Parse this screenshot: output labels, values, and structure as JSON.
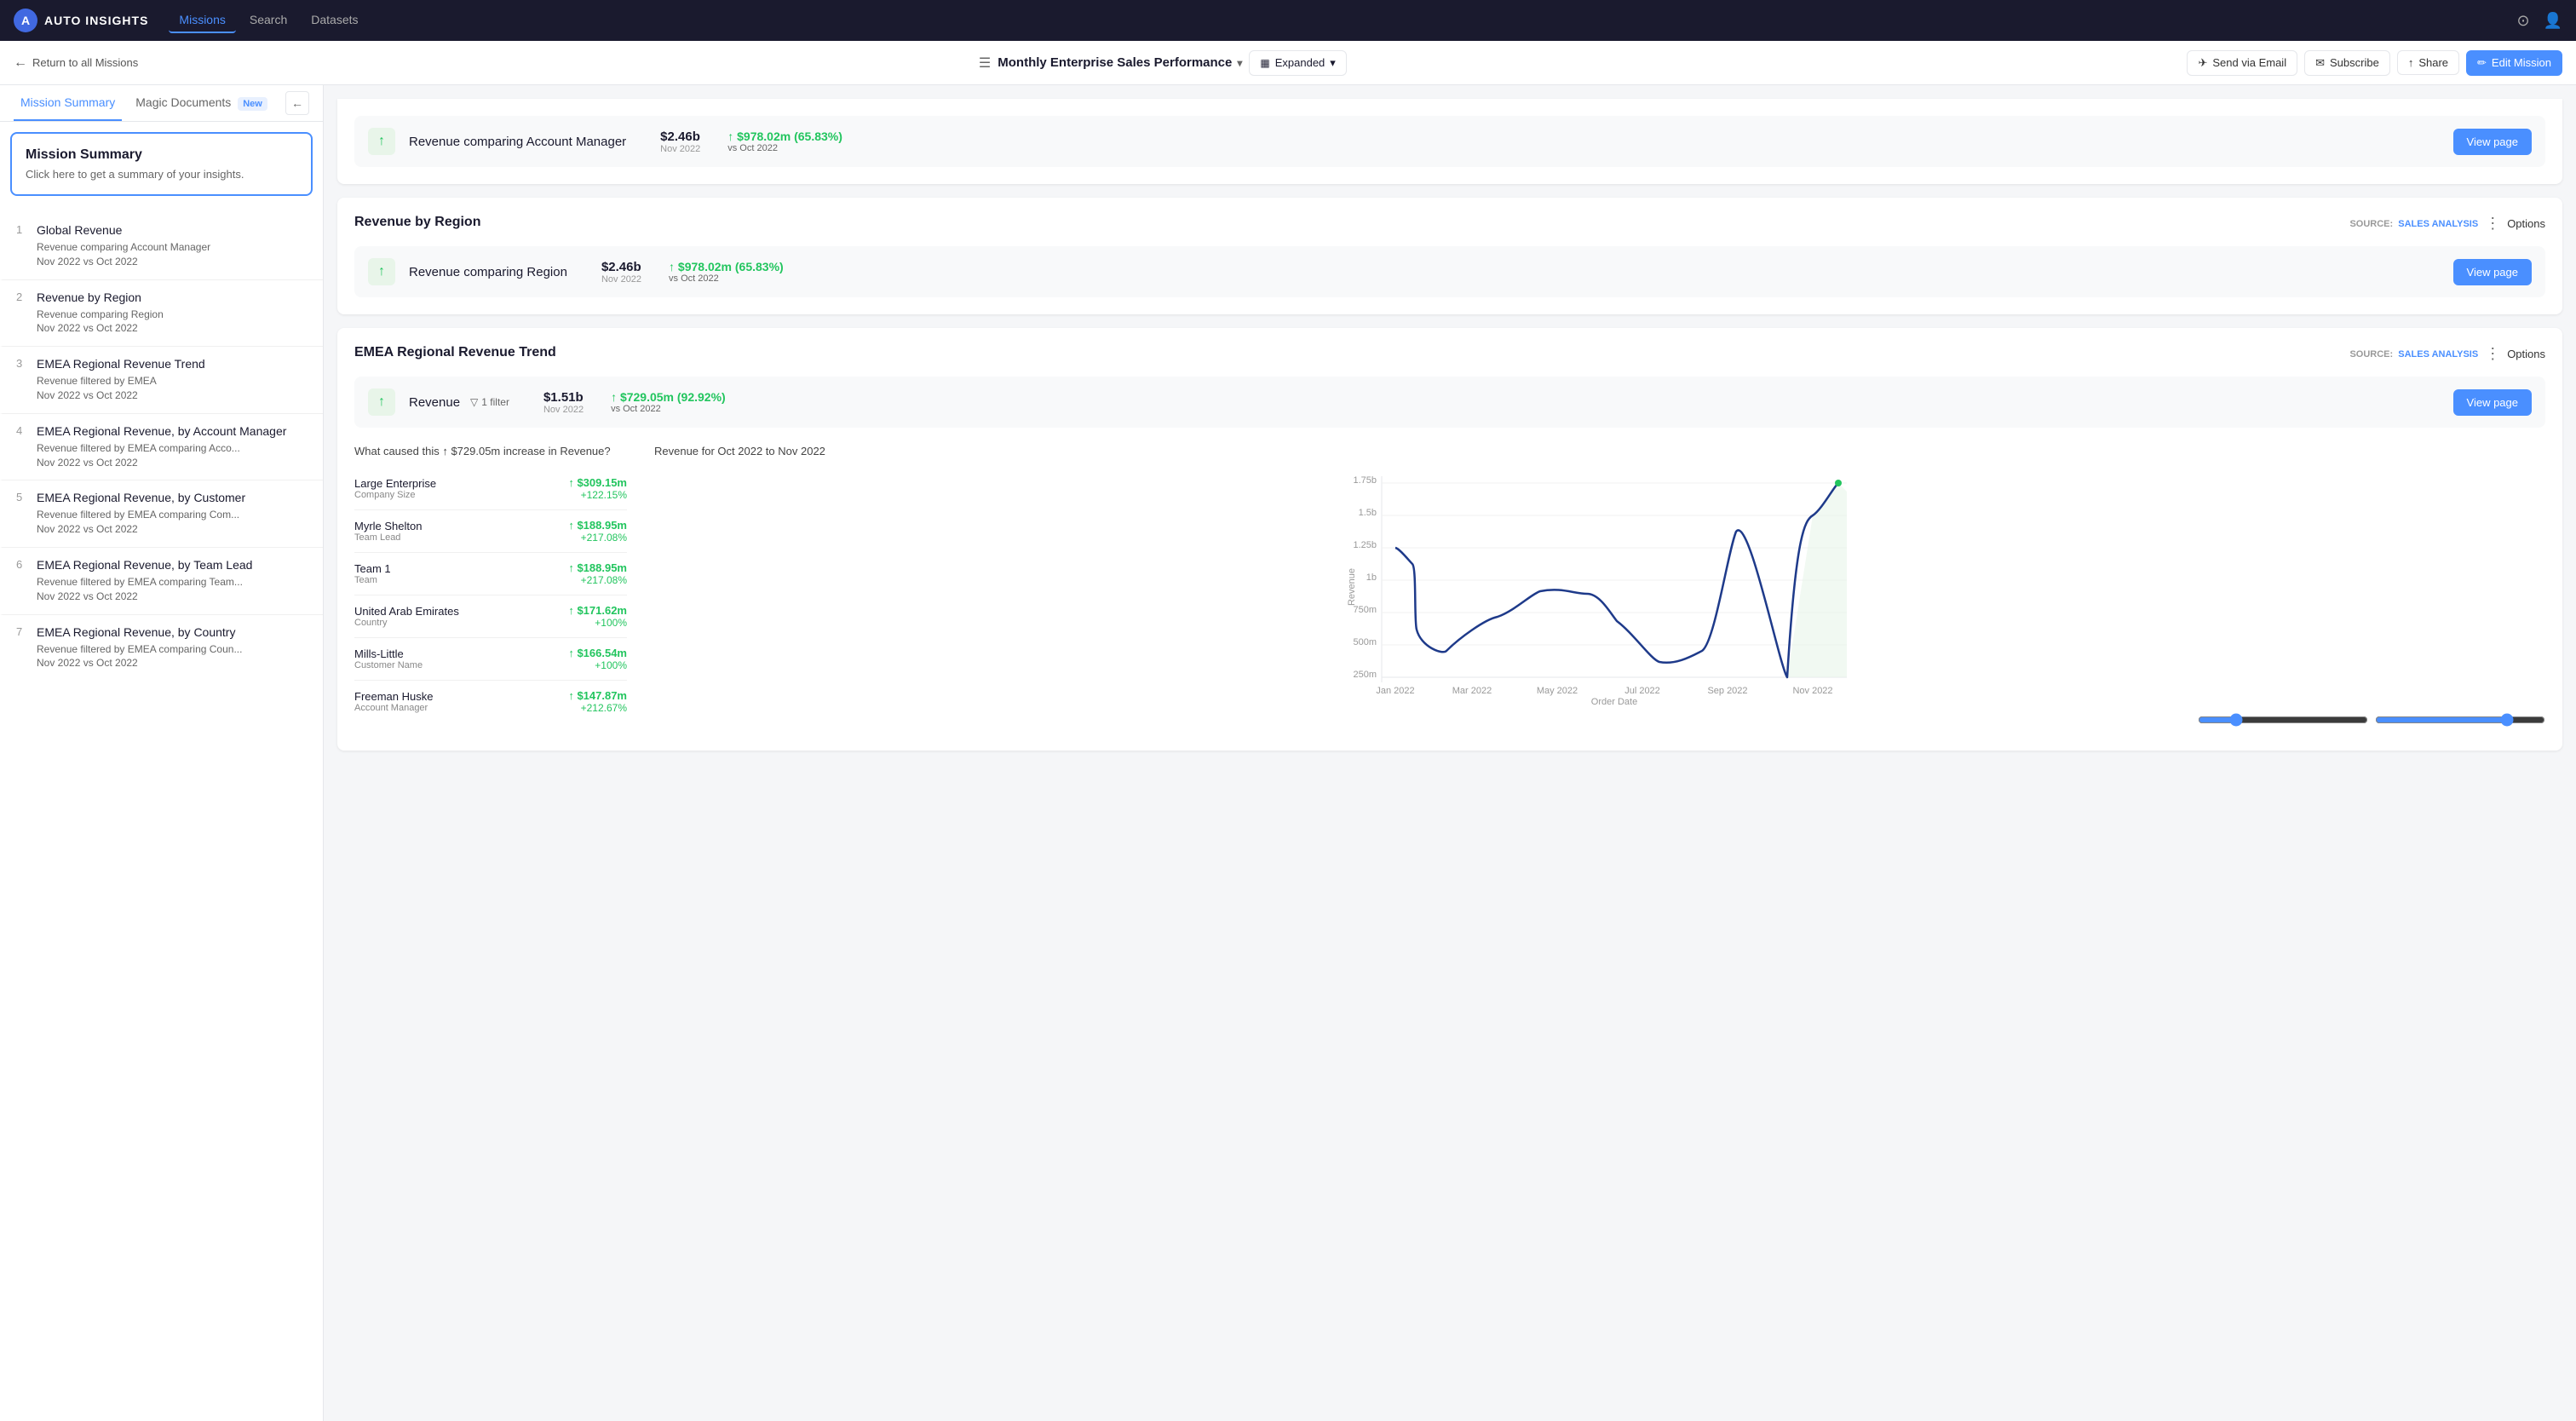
{
  "nav": {
    "logo_icon": "A",
    "logo_text": "AUTO INSIGHTS",
    "items": [
      "Missions",
      "Search",
      "Datasets"
    ],
    "active_item": "Missions",
    "help_icon": "?",
    "user_icon": "👤"
  },
  "sub_header": {
    "back_label": "Return to all Missions",
    "mission_title": "Monthly Enterprise Sales Performance",
    "view_mode": "Expanded",
    "actions": {
      "send_email": "Send via Email",
      "subscribe": "Subscribe",
      "share": "Share",
      "edit": "Edit Mission"
    }
  },
  "sidebar": {
    "tabs": [
      {
        "label": "Mission Summary",
        "active": true
      },
      {
        "label": "Magic Documents",
        "badge": "New",
        "active": false
      }
    ],
    "mission_summary_card": {
      "title": "Mission Summary",
      "subtitle": "Click here to get a summary of your insights."
    },
    "items": [
      {
        "num": "1",
        "title": "Global Revenue",
        "line1": "Revenue comparing Account Manager",
        "line2": "Nov 2022 vs Oct 2022"
      },
      {
        "num": "2",
        "title": "Revenue by Region",
        "line1": "Revenue comparing Region",
        "line2": "Nov 2022 vs Oct 2022"
      },
      {
        "num": "3",
        "title": "EMEA Regional Revenue Trend",
        "line1": "Revenue filtered by EMEA",
        "line2": "Nov 2022 vs Oct 2022"
      },
      {
        "num": "4",
        "title": "EMEA Regional Revenue, by Account Manager",
        "line1": "Revenue filtered by EMEA comparing Acco...",
        "line2": "Nov 2022 vs Oct 2022"
      },
      {
        "num": "5",
        "title": "EMEA Regional Revenue, by Customer",
        "line1": "Revenue filtered by EMEA comparing Com...",
        "line2": "Nov 2022 vs Oct 2022"
      },
      {
        "num": "6",
        "title": "EMEA Regional Revenue, by Team Lead",
        "line1": "Revenue filtered by EMEA comparing Team...",
        "line2": "Nov 2022 vs Oct 2022"
      },
      {
        "num": "7",
        "title": "EMEA Regional Revenue, by Country",
        "line1": "Revenue filtered by EMEA comparing Coun...",
        "line2": "Nov 2022 vs Oct 2022"
      }
    ]
  },
  "cards": {
    "global_revenue": {
      "metric_label": "Revenue comparing Account Manager",
      "metric_value": "$2.46b",
      "metric_period": "Nov 2022",
      "metric_change": "↑ $978.02m (65.83%)",
      "metric_change_vs": "vs Oct 2022",
      "view_page": "View page"
    },
    "revenue_by_region": {
      "title": "Revenue by Region",
      "source_label": "SOURCE:",
      "source_name": "SALES ANALYSIS",
      "options": "Options",
      "metric_label": "Revenue comparing Region",
      "metric_value": "$2.46b",
      "metric_period": "Nov 2022",
      "metric_change": "↑ $978.02m (65.83%)",
      "metric_change_vs": "vs Oct 2022",
      "view_page": "View page"
    },
    "emea_trend": {
      "title": "EMEA Regional Revenue Trend",
      "source_label": "SOURCE:",
      "source_name": "SALES ANALYSIS",
      "options": "Options",
      "metric_label": "Revenue",
      "filter_label": "1 filter",
      "metric_value": "$1.51b",
      "metric_period": "Nov 2022",
      "metric_change": "↑ $729.05m (92.92%)",
      "metric_change_vs": "vs Oct 2022",
      "view_page": "View page",
      "analysis_question": "What caused this ↑ $729.05m increase in Revenue?",
      "chart_title": "Revenue for Oct 2022 to Nov 2022",
      "chart_x_label": "Order Date",
      "chart_y_label": "Revenue",
      "chart_y_ticks": [
        "1.75b",
        "1.5b",
        "1.25b",
        "1b",
        "750m",
        "500m",
        "250m"
      ],
      "chart_x_ticks": [
        "Jan 2022",
        "Mar 2022",
        "May 2022",
        "Jul 2022",
        "Sep 2022",
        "Nov 2022"
      ],
      "factors": [
        {
          "name": "Large Enterprise",
          "category": "Company Size",
          "value": "↑ $309.15m",
          "pct": "+122.15%"
        },
        {
          "name": "Myrle Shelton",
          "category": "Team Lead",
          "value": "↑ $188.95m",
          "pct": "+217.08%"
        },
        {
          "name": "Team 1",
          "category": "Team",
          "value": "↑ $188.95m",
          "pct": "+217.08%"
        },
        {
          "name": "United Arab Emirates",
          "category": "Country",
          "value": "↑ $171.62m",
          "pct": "+100%"
        },
        {
          "name": "Mills-Little",
          "category": "Customer Name",
          "value": "↑ $166.54m",
          "pct": "+100%"
        },
        {
          "name": "Freeman Huske",
          "category": "Account Manager",
          "value": "↑ $147.87m",
          "pct": "+212.67%"
        }
      ]
    }
  }
}
